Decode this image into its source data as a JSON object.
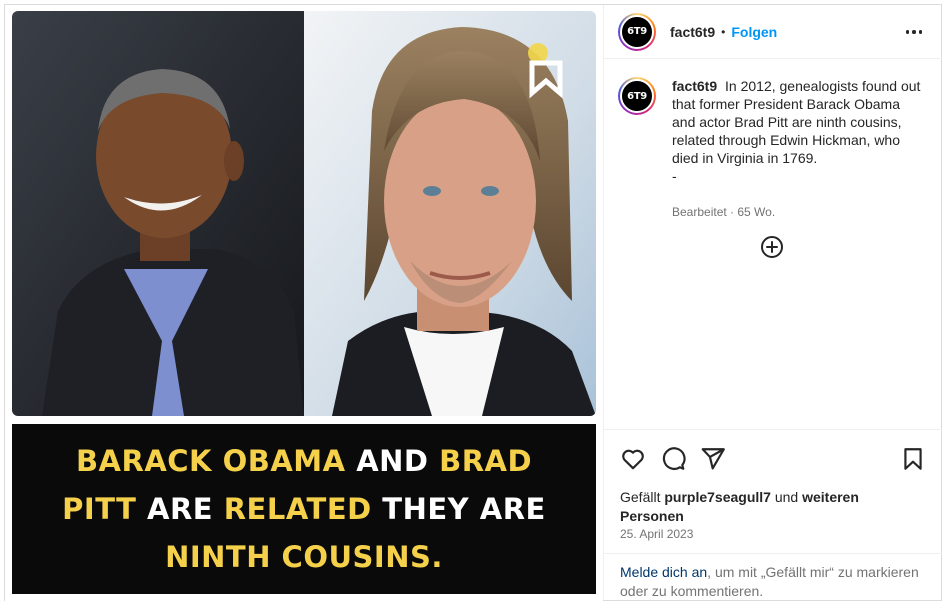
{
  "post": {
    "username": "fact6t9",
    "avatar_text": "6T9",
    "dot": "•",
    "follow_label": "Folgen",
    "more_icon": "more-horizontal-icon",
    "caption": "In 2012, genealogists found out that former President Barack Obama and actor Brad Pitt are ninth cousins, related through Edwin Hickman, who died in Virginia in 1769.",
    "caption_suffix": "-",
    "edited_label": "Bearbeitet",
    "edited_sep": " · ",
    "edited_time": "65 Wo."
  },
  "media": {
    "image_text": {
      "line1": [
        {
          "t": "BARACK OBAMA ",
          "c": "y"
        },
        {
          "t": "AND ",
          "c": "w"
        },
        {
          "t": "BRAD",
          "c": "y"
        }
      ],
      "line2": [
        {
          "t": "PITT ",
          "c": "y"
        },
        {
          "t": "ARE ",
          "c": "w"
        },
        {
          "t": "RELATED ",
          "c": "y"
        },
        {
          "t": "THEY ARE",
          "c": "w"
        }
      ],
      "line3": [
        {
          "t": "NINTH COUSINS.",
          "c": "y"
        }
      ]
    },
    "colors": {
      "yellow": "#f5d04a",
      "white": "#ffffff",
      "black": "#0a0a0a"
    }
  },
  "actions": {
    "like_icon": "heart-icon",
    "comment_icon": "comment-icon",
    "share_icon": "send-icon",
    "save_icon": "bookmark-icon",
    "add_comment_icon": "plus-circle-icon"
  },
  "likes": {
    "prefix": "Gefällt ",
    "user": "purple7seagull7",
    "middle": " und ",
    "others": "weiteren Personen"
  },
  "date": "25. April 2023",
  "login": {
    "link": "Melde dich an",
    "rest": ", um mit „Gefällt mir“ zu markieren oder zu kommentieren."
  }
}
